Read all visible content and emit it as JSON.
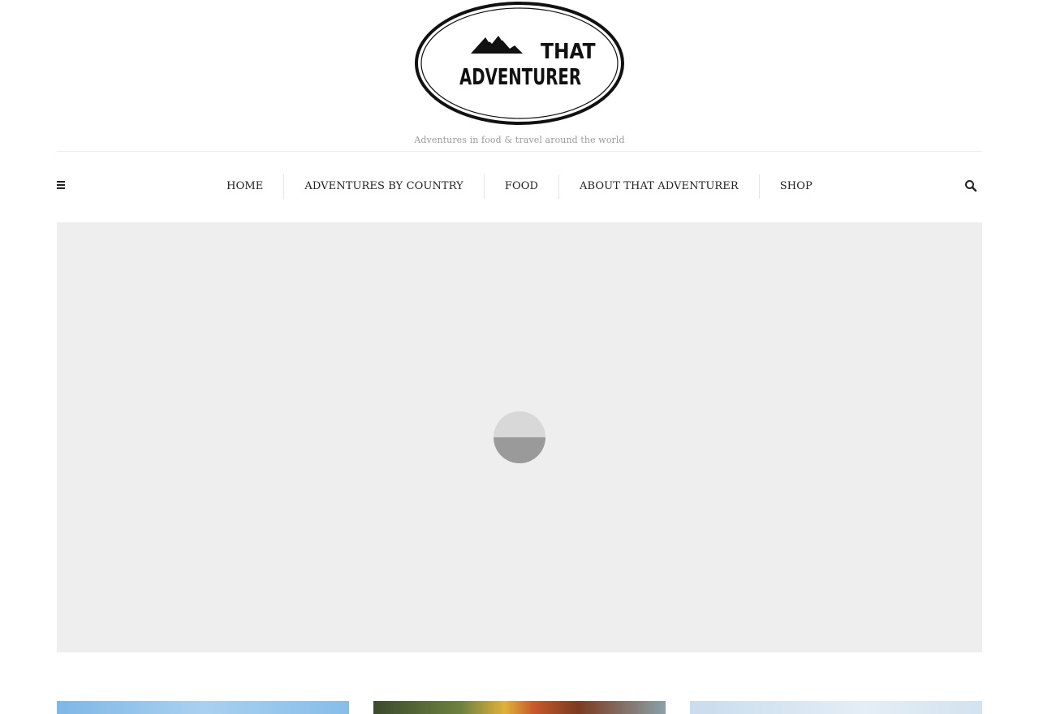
{
  "site": {
    "logo": {
      "line1": "THAT",
      "line2": "ADVENTURER"
    },
    "tagline": "Adventures in food & travel around the world"
  },
  "nav": {
    "menu_toggle_icon": "hamburger-icon",
    "search_icon": "search-icon",
    "items": [
      {
        "label": "HOME"
      },
      {
        "label": "ADVENTURES BY COUNTRY"
      },
      {
        "label": "FOOD"
      },
      {
        "label": "ABOUT THAT ADVENTURER"
      },
      {
        "label": "SHOP"
      }
    ]
  },
  "hero": {
    "state": "loading",
    "loader_icon": "spinner-icon"
  },
  "colors": {
    "text": "#222222",
    "tagline": "#9a9a9a",
    "hero_bg": "#eeeeee",
    "divider": "#e5e5e5"
  }
}
